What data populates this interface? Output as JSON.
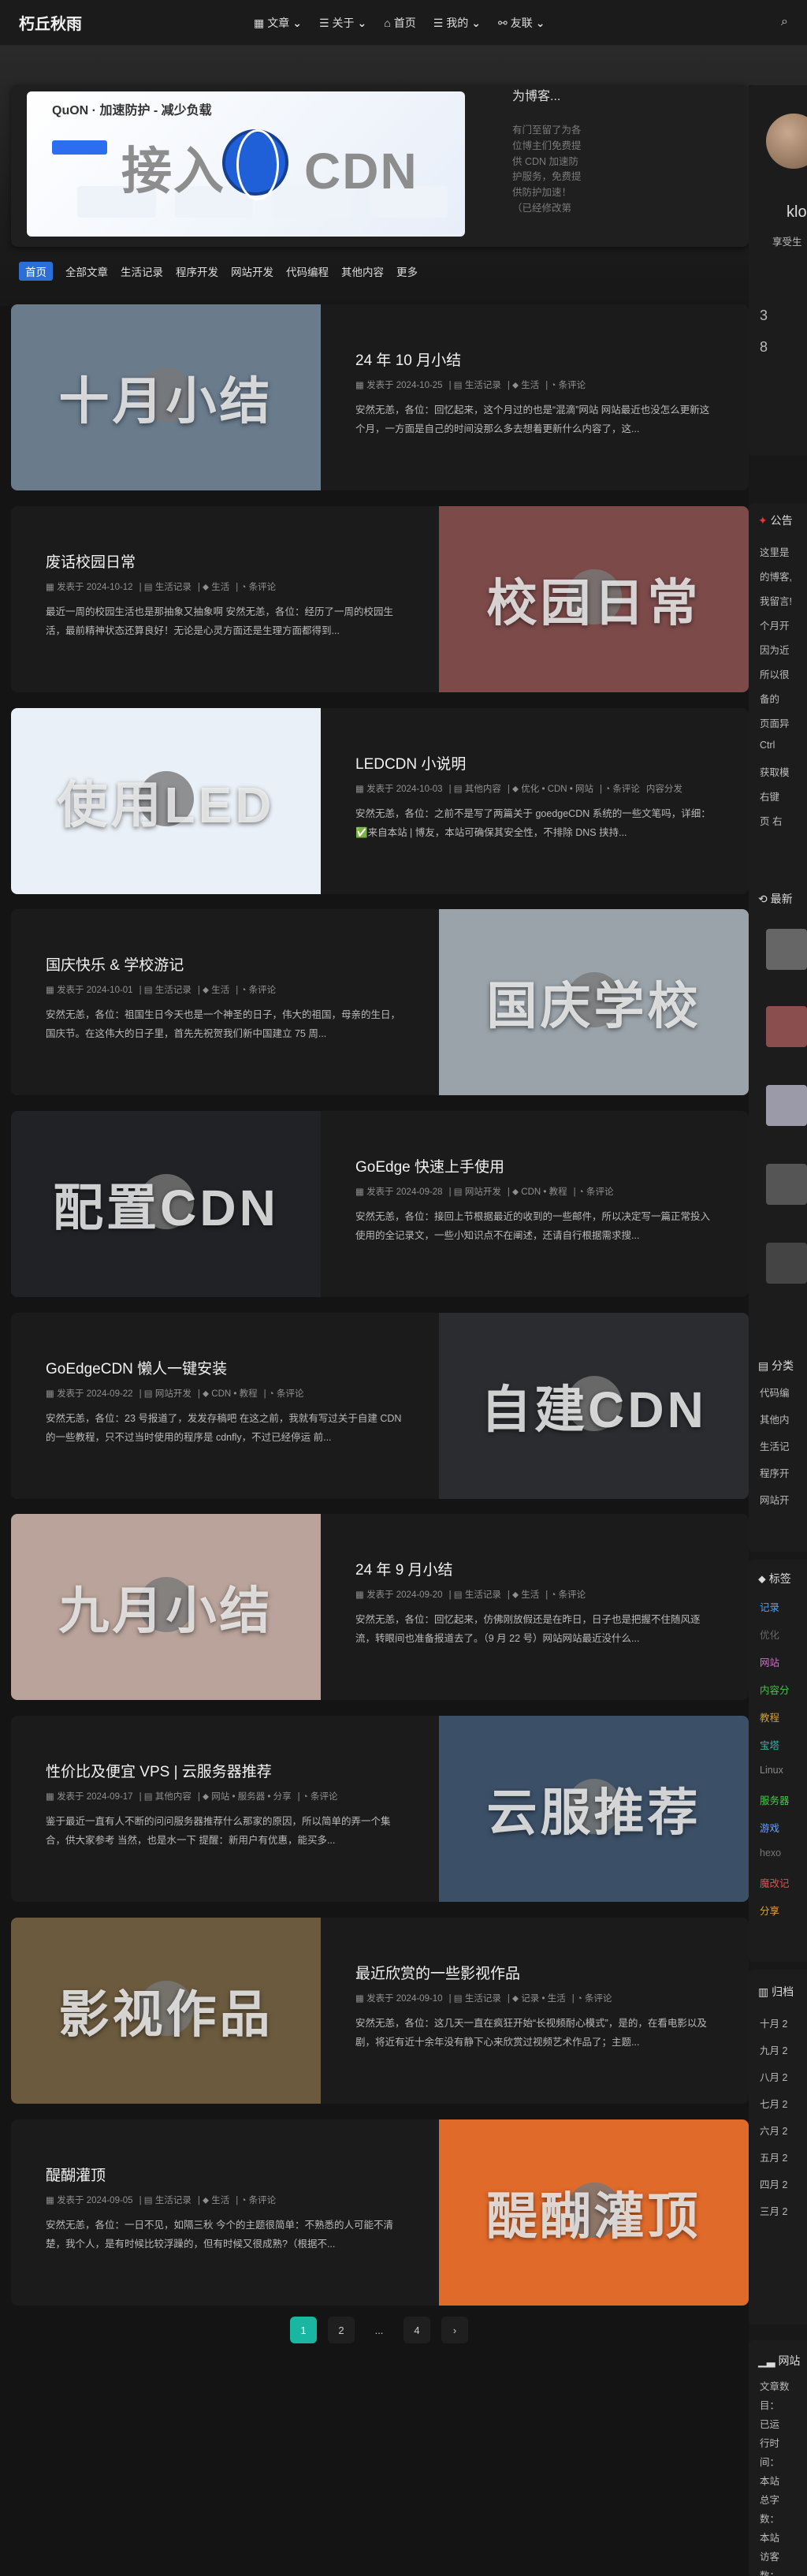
{
  "site": {
    "brand": "朽丘秋雨"
  },
  "nav": {
    "items": [
      {
        "label": "文章",
        "icon": "folder-icon"
      },
      {
        "label": "关于",
        "icon": "list-icon"
      },
      {
        "label": "首页",
        "icon": "home-icon"
      },
      {
        "label": "我的",
        "icon": "list-icon"
      },
      {
        "label": "友联",
        "icon": "link-icon"
      }
    ]
  },
  "notice": {
    "banner_brand": "QuON · 加速防护 - 减少负载",
    "banner_title": "接入",
    "banner_title2": "CDN",
    "side_title": "为博客...",
    "side_text": "有门至留了为各位博主们免费提供 CDN 加速防护服务，免费提供防护加速！（已经修改第"
  },
  "categories": [
    "首页",
    "全部文章",
    "生活记录",
    "程序开发",
    "网站开发",
    "代码编程",
    "其他内容",
    "更多"
  ],
  "posts": [
    {
      "title": "24 年 10 月小结",
      "thumb": "十月小结",
      "date": "发表于 2024-10-25",
      "cat": "生活记录",
      "tags": "生活",
      "comments": "条评论",
      "excerpt": "安然无恙，各位：回忆起来，这个月过的也是“混滴”网站 网站最近也没怎么更新这个月，一方面是自己的时间没那么多去想着更新什么内容了，这..."
    },
    {
      "title": "废话校园日常",
      "thumb": "校园日常",
      "date": "发表于 2024-10-12",
      "cat": "生活记录",
      "tags": "生活",
      "comments": "条评论",
      "excerpt": "最近一周的校园生活也是那抽象又抽象啊 安然无恙，各位：经历了一周的校园生活，最前精神状态还算良好！无论是心灵方面还是生理方面都得到..."
    },
    {
      "title": "LEDCDN 小说明",
      "thumb": "使用LED",
      "date": "发表于 2024-10-03",
      "cat": "其他内容",
      "tags": "优化 • CDN • 网站",
      "comments": "条评论",
      "extra": "内容分发",
      "excerpt": "安然无恙，各位：之前不是写了两篇关于 goedgeCDN 系统的一些文笔吗，详细：✅来自本站 | 博友，本站可确保其安全性，不排除 DNS 挟持..."
    },
    {
      "title": "国庆快乐 & 学校游记",
      "thumb": "国庆学校",
      "date": "发表于 2024-10-01",
      "cat": "生活记录",
      "tags": "生活",
      "comments": "条评论",
      "excerpt": "安然无恙，各位：祖国生日今天也是一个神圣的日子，伟大的祖国，母亲的生日，国庆节。在这伟大的日子里，首先先祝贺我们新中国建立 75 周..."
    },
    {
      "title": "GoEdge 快速上手使用",
      "thumb": "配置CDN",
      "date": "发表于 2024-09-28",
      "cat": "网站开发",
      "tags": "CDN • 教程",
      "comments": "条评论",
      "excerpt": "安然无恙，各位：接回上节根据最近的收到的一些邮件，所以决定写一篇正常投入使用的全记录文，一些小知识点不在阐述，还请自行根据需求搜..."
    },
    {
      "title": "GoEdgeCDN 懒人一键安装",
      "thumb": "自建CDN",
      "date": "发表于 2024-09-22",
      "cat": "网站开发",
      "tags": "CDN • 教程",
      "comments": "条评论",
      "excerpt": "安然无恙，各位：23 号报道了，发发存稿吧 在这之前，我就有写过关于自建 CDN 的一些教程，只不过当时使用的程序是 cdnfly，不过已经停运 前..."
    },
    {
      "title": "24 年 9 月小结",
      "thumb": "九月小结",
      "date": "发表于 2024-09-20",
      "cat": "生活记录",
      "tags": "生活",
      "comments": "条评论",
      "excerpt": "安然无恙，各位：回忆起来，仿佛刚放假还是在昨日，日子也是把握不住随风逐流，转眼间也准备报道去了。（9 月 22 号）网站网站最近没什么..."
    },
    {
      "title": "性价比及便宜 VPS | 云服务器推荐",
      "thumb": "云服推荐",
      "date": "发表于 2024-09-17",
      "cat": "其他内容",
      "tags": "网站 • 服务器 • 分享",
      "comments": "条评论",
      "excerpt": "鉴于最近一直有人不断的问问服务器推荐什么那家的原因，所以简单的弄一个集合，供大家参考 当然，也是水一下 提醒：新用户有优惠，能买多..."
    },
    {
      "title": "最近欣赏的一些影视作品",
      "thumb": "影视作品",
      "date": "发表于 2024-09-10",
      "cat": "生活记录",
      "tags": "记录 • 生活",
      "comments": "条评论",
      "excerpt": "安然无恙，各位：这几天一直在疯狂开始“长视频耐心模式”，是的，在看电影以及剧，将近有近十余年没有静下心来欣赏过视频艺术作品了；主题..."
    },
    {
      "title": "醍醐灌顶",
      "thumb": "醍醐灌顶",
      "date": "发表于 2024-09-05",
      "cat": "生活记录",
      "tags": "生活",
      "comments": "条评论",
      "excerpt": "安然无恙，各位：一日不见，如隔三秋 今个的主题很简单：不熟悉的人可能不清楚，我个人，是有时候比较浮躁的，但有时候又很成熟?（根据不..."
    }
  ],
  "pager": {
    "p1": "1",
    "p2": "2",
    "dots": "...",
    "p4": "4",
    "next": "›"
  },
  "sidebar": {
    "profile_name": "klo",
    "profile_desc": "享受生",
    "stat_a": "3",
    "stat_b": "8",
    "announce_title": "公告",
    "announce_lines": [
      "这里是",
      "的博客,",
      "我留言!",
      "个月开",
      "因为近",
      "所以很",
      "备的",
      "页面异",
      "Ctrl",
      "获取模",
      "右键",
      "页 右"
    ],
    "recent_title": "最新",
    "cat_title": "分类",
    "cat_items": [
      "代码编",
      "其他内",
      "生活记",
      "程序开",
      "网站开"
    ],
    "tag_title": "标签",
    "tags": [
      "记录",
      "优化",
      "网站",
      "内容分",
      "教程",
      "宝塔",
      "Linux",
      "服务器",
      "游戏",
      "hexo",
      "魔改记",
      "分享"
    ],
    "archive_title": "归档",
    "archive_items": [
      "十月 2",
      "九月 2",
      "八月 2",
      "七月 2",
      "六月 2",
      "五月 2",
      "四月 2",
      "三月 2"
    ],
    "site_title": "网站",
    "site_lines": [
      "文章数",
      "目：",
      "已运",
      "行时",
      "间：",
      "本站",
      "总字",
      "数：",
      "本站",
      "访客",
      "数：",
      "本"
    ]
  },
  "colors": {
    "accent": "#19b7a1",
    "category_active": "#2b6fd6",
    "card": "#1b1b1b"
  }
}
